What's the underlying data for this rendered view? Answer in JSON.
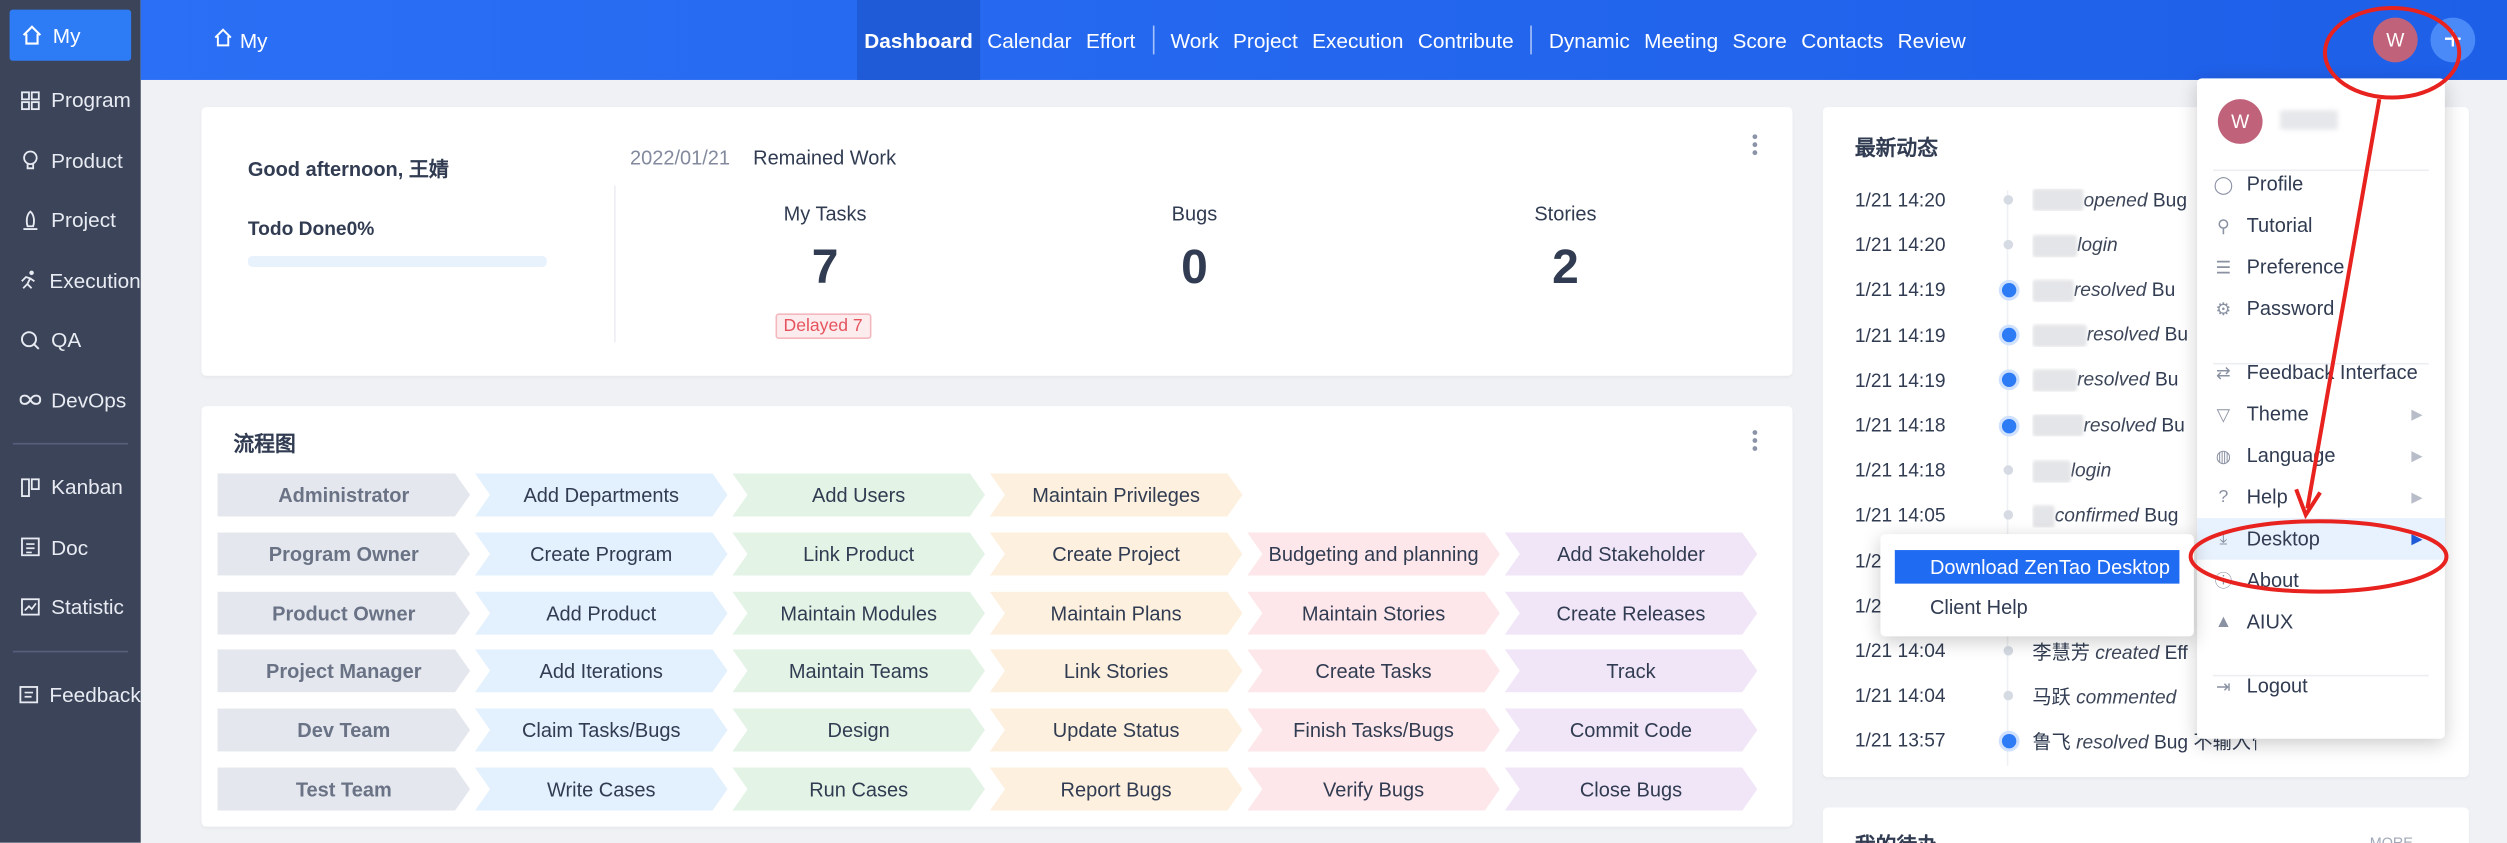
{
  "sidebar": {
    "items": [
      {
        "label": "My",
        "icon": "home-icon",
        "active": true
      },
      {
        "label": "Program",
        "icon": "grid-icon"
      },
      {
        "label": "Product",
        "icon": "bulb-icon"
      },
      {
        "label": "Project",
        "icon": "project-icon"
      },
      {
        "label": "Execution",
        "icon": "run-icon"
      },
      {
        "label": "QA",
        "icon": "qa-icon"
      },
      {
        "label": "DevOps",
        "icon": "infinity-icon"
      }
    ],
    "items2": [
      {
        "label": "Kanban",
        "icon": "kanban-icon"
      },
      {
        "label": "Doc",
        "icon": "doc-icon"
      },
      {
        "label": "Statistic",
        "icon": "chart-icon"
      }
    ],
    "feedback": {
      "label": "Feedback",
      "icon": "feedback-icon"
    }
  },
  "topbar": {
    "home_label": "My",
    "nav1": [
      "Dashboard",
      "Calendar",
      "Effort"
    ],
    "nav2": [
      "Work",
      "Project",
      "Execution",
      "Contribute"
    ],
    "nav3": [
      "Dynamic",
      "Meeting",
      "Score",
      "Contacts",
      "Review"
    ],
    "avatar": "W",
    "plus": "+"
  },
  "welcome": {
    "greeting": "Good afternoon, 王婧",
    "todo": "Todo Done0%",
    "todo_progress": 0,
    "date": "2022/01/21",
    "remained": "Remained Work",
    "stats": [
      {
        "label": "My Tasks",
        "value": "7"
      },
      {
        "label": "Bugs",
        "value": "0"
      },
      {
        "label": "Stories",
        "value": "2"
      }
    ],
    "delayed": "Delayed 7"
  },
  "flow": {
    "title": "流程图",
    "rows": [
      {
        "role": "Administrator",
        "steps": [
          "Add Departments",
          "Add Users",
          "Maintain Privileges"
        ]
      },
      {
        "role": "Program Owner",
        "steps": [
          "Create Program",
          "Link Product",
          "Create Project",
          "Budgeting and planning",
          "Add Stakeholder"
        ]
      },
      {
        "role": "Product Owner",
        "steps": [
          "Add Product",
          "Maintain Modules",
          "Maintain Plans",
          "Maintain Stories",
          "Create Releases"
        ]
      },
      {
        "role": "Project Manager",
        "steps": [
          "Add Iterations",
          "Maintain Teams",
          "Link Stories",
          "Create Tasks",
          "Track"
        ]
      },
      {
        "role": "Dev Team",
        "steps": [
          "Claim Tasks/Bugs",
          "Design",
          "Update Status",
          "Finish Tasks/Bugs",
          "Commit Code"
        ]
      },
      {
        "role": "Test Team",
        "steps": [
          "Write Cases",
          "Run Cases",
          "Report Bugs",
          "Verify Bugs",
          "Close Bugs"
        ]
      }
    ]
  },
  "activity": {
    "title": "最新动态",
    "rows": [
      {
        "time": "1/21 14:20",
        "action": "opened",
        "rest": "Bug",
        "dot": "grey"
      },
      {
        "time": "1/21 14:20",
        "action": "login",
        "rest": "",
        "dot": "grey"
      },
      {
        "time": "1/21 14:19",
        "action": "resolved",
        "rest": "Bu",
        "dot": "blue"
      },
      {
        "time": "1/21 14:19",
        "action": "resolved",
        "rest": "Bu",
        "dot": "blue"
      },
      {
        "time": "1/21 14:19",
        "action": "resolved",
        "rest": "Bu",
        "dot": "blue"
      },
      {
        "time": "1/21 14:18",
        "action": "resolved",
        "rest": "Bu",
        "dot": "blue"
      },
      {
        "time": "1/21 14:18",
        "action": "login",
        "rest": "",
        "dot": "grey"
      },
      {
        "time": "1/21 14:05",
        "action": "confirmed",
        "rest": "Bug",
        "dot": "grey"
      },
      {
        "time": "1/2",
        "action": "",
        "rest": "",
        "dot": "grey"
      },
      {
        "time": "1/2",
        "action": "",
        "rest": "",
        "dot": "grey"
      },
      {
        "time": "1/21 14:04",
        "action": "created",
        "rest": "Eff",
        "who": "李慧芳",
        "dot": "grey"
      },
      {
        "time": "1/21 14:04",
        "action": "commented",
        "rest": "",
        "who": "马跃",
        "dot": "grey"
      },
      {
        "time": "1/21 13:57",
        "action": "resolved",
        "rest": "Bug 不输入管理员密码重表...",
        "who": "鲁飞",
        "dot": "blue"
      }
    ]
  },
  "todo_card": {
    "title": "我的待办",
    "more": "MORE"
  },
  "user_menu": {
    "avatar": "W",
    "items": [
      {
        "label": "Profile",
        "icon": "user-icon"
      },
      {
        "label": "Tutorial",
        "icon": "pin-icon"
      },
      {
        "label": "Preference",
        "icon": "sliders-icon"
      },
      {
        "label": "Password",
        "icon": "gear-icon"
      },
      {
        "label": "Feedback Interface",
        "icon": "swap-icon"
      },
      {
        "label": "Theme",
        "icon": "shirt-icon",
        "submenu": true
      },
      {
        "label": "Language",
        "icon": "globe-icon",
        "submenu": true
      },
      {
        "label": "Help",
        "icon": "help-icon",
        "submenu": true
      },
      {
        "label": "Desktop",
        "icon": "download-icon",
        "submenu": true,
        "active": true
      },
      {
        "label": "About",
        "icon": "info-icon"
      },
      {
        "label": "AIUX",
        "icon": "aiux-icon"
      },
      {
        "label": "Logout",
        "icon": "logout-icon"
      }
    ]
  },
  "desktop_submenu": {
    "items": [
      "Download ZenTao Desktop",
      "Client Help"
    ]
  },
  "colors": {
    "primary": "#2e7bf6",
    "sidebar": "#3b4459",
    "annotation": "#e8221f"
  }
}
